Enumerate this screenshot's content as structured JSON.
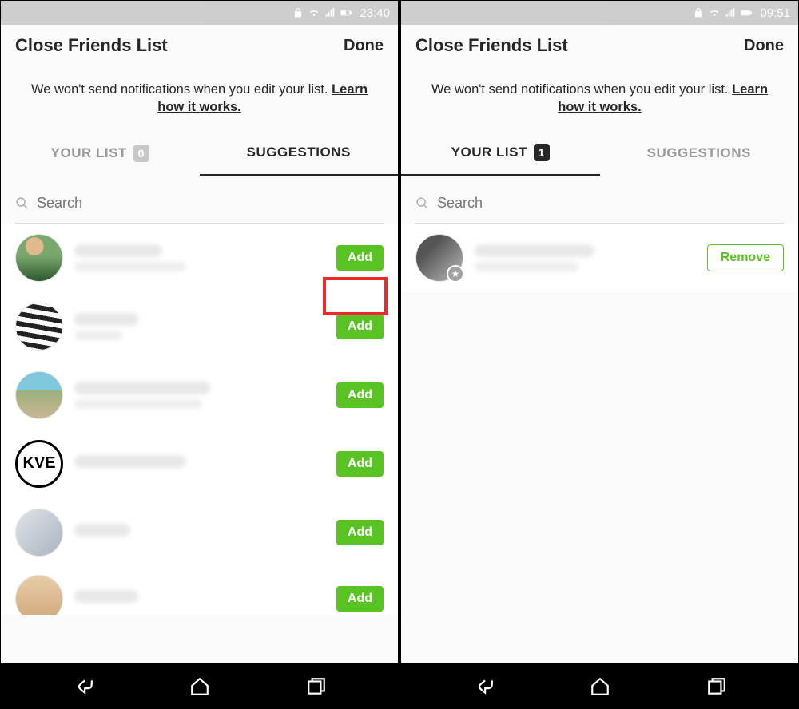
{
  "left": {
    "status_time": "23:40",
    "title": "Close Friends List",
    "done": "Done",
    "note_main": "We won't send notifications when you edit your list. ",
    "note_learn": "Learn how it works.",
    "tab_yourlist": "YOUR LIST",
    "yourlist_count": "0",
    "tab_suggestions": "SUGGESTIONS",
    "search_placeholder": "Search",
    "suggestions": [
      {
        "add": "Add"
      },
      {
        "add": "Add"
      },
      {
        "add": "Add"
      },
      {
        "add": "Add"
      },
      {
        "add": "Add"
      },
      {
        "add": "Add"
      }
    ]
  },
  "right": {
    "status_time": "09:51",
    "title": "Close Friends List",
    "done": "Done",
    "note_main": "We won't send notifications when you edit your list. ",
    "note_learn": "Learn how it works.",
    "tab_yourlist": "YOUR LIST",
    "yourlist_count": "1",
    "tab_suggestions": "SUGGESTIONS",
    "search_placeholder": "Search",
    "list": [
      {
        "remove": "Remove"
      }
    ]
  }
}
